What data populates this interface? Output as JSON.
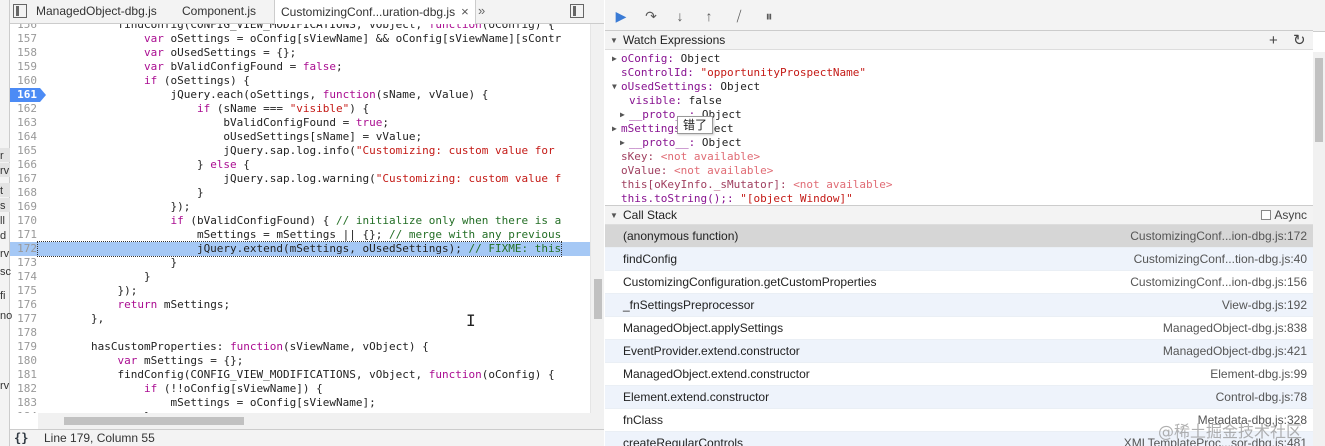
{
  "left_strip": {
    "labels": [
      "r",
      "rv",
      "t",
      "s",
      "ll",
      "d",
      "rv",
      "sc",
      "fi",
      "no",
      "rv"
    ]
  },
  "tabs": [
    {
      "label": "ManagedObject-dbg.js"
    },
    {
      "label": "Component.js"
    },
    {
      "label": "CustomizingConf...uration-dbg.js",
      "close": "×"
    }
  ],
  "more_tabs": "»",
  "code_lines": [
    {
      "n": "156",
      "html": "            findConfig(CONFIG_VIEW_MODIFICATIONS, vObject, <span class=\"kw\">function</span>(oConfig) {"
    },
    {
      "n": "157",
      "html": "                <span class=\"kw\">var</span> oSettings = oConfig[sViewName] &amp;&amp; oConfig[sViewName][sContr"
    },
    {
      "n": "158",
      "html": "                <span class=\"kw\">var</span> oUsedSettings = {};"
    },
    {
      "n": "159",
      "html": "                <span class=\"kw\">var</span> bValidConfigFound = <span class=\"kw\">false</span>;"
    },
    {
      "n": "160",
      "html": "                <span class=\"kw\">if</span> (oSettings) {"
    },
    {
      "n": "161",
      "html": "                    jQuery.each(oSettings, <span class=\"kw\">function</span>(sName, vValue) {",
      "bp": true
    },
    {
      "n": "162",
      "html": "                        <span class=\"kw\">if</span> (sName === <span class=\"st\">\"visible\"</span>) {"
    },
    {
      "n": "163",
      "html": "                            bValidConfigFound = <span class=\"kw\">true</span>;"
    },
    {
      "n": "164",
      "html": "                            oUsedSettings[sName] = vValue;"
    },
    {
      "n": "165",
      "html": "                            jQuery.sap.log.info(<span class=\"st\">\"Customizing: custom value for</span>"
    },
    {
      "n": "166",
      "html": "                        } <span class=\"kw\">else</span> {"
    },
    {
      "n": "167",
      "html": "                            jQuery.sap.log.warning(<span class=\"st\">\"Customizing: custom value f</span>"
    },
    {
      "n": "168",
      "html": "                        }"
    },
    {
      "n": "169",
      "html": "                    });"
    },
    {
      "n": "170",
      "html": "                    <span class=\"kw\">if</span> (bValidConfigFound) { <span class=\"cm\">// initialize only when there is a</span>"
    },
    {
      "n": "171",
      "html": "                        mSettings = mSettings || {}; <span class=\"cm\">// merge with any previous</span>"
    },
    {
      "n": "172",
      "html": "                        jQuery.extend(mSettings, oUsedSettings); <span class=\"cm\">// FIXME: this</span>",
      "hl": true
    },
    {
      "n": "173",
      "html": "                    }"
    },
    {
      "n": "174",
      "html": "                }"
    },
    {
      "n": "175",
      "html": "            });"
    },
    {
      "n": "176",
      "html": "            <span class=\"kw\">return</span> mSettings;"
    },
    {
      "n": "177",
      "html": "        },"
    },
    {
      "n": "178",
      "html": ""
    },
    {
      "n": "179",
      "html": "        hasCustomProperties: <span class=\"kw\">function</span>(sViewName, vObject) {"
    },
    {
      "n": "180",
      "html": "            <span class=\"kw\">var</span> mSettings = {};"
    },
    {
      "n": "181",
      "html": "            findConfig(CONFIG_VIEW_MODIFICATIONS, vObject, <span class=\"kw\">function</span>(oConfig) {"
    },
    {
      "n": "182",
      "html": "                <span class=\"kw\">if</span> (!!oConfig[sViewName]) {"
    },
    {
      "n": "183",
      "html": "                    mSettings = oConfig[sViewName];"
    },
    {
      "n": "184",
      "html": "                }"
    }
  ],
  "status": {
    "braces": "{}",
    "position": "Line 179, Column 55"
  },
  "toolbar": {
    "resume": "▶",
    "step_over": "↷",
    "step_into": "↓",
    "step_out": "↑",
    "deactivate": "⧸",
    "pause_exceptions": "⏸"
  },
  "watch": {
    "title": "Watch Expressions",
    "add": "+",
    "refresh": "↻",
    "lines": [
      {
        "tri": "▶",
        "indent": 0,
        "name": "oConfig",
        "sep": ": ",
        "val": "Object",
        "kind": "obj"
      },
      {
        "tri": "",
        "indent": 0,
        "name": "sControlId",
        "sep": ": ",
        "val": "\"opportunityProspectName\"",
        "kind": "str"
      },
      {
        "tri": "▼",
        "indent": 0,
        "name": "oUsedSettings",
        "sep": ": ",
        "val": "Object",
        "kind": "obj"
      },
      {
        "tri": "",
        "indent": 1,
        "name": "visible",
        "sep": ": ",
        "val": "false",
        "kind": "obj"
      },
      {
        "tri": "▶",
        "indent": 1,
        "name": "__proto__",
        "sep": ": ",
        "val": "Object",
        "kind": "obj"
      },
      {
        "tri": "▶",
        "indent": 0,
        "name": "mSettings",
        "sep": ": ",
        "val": "Object",
        "kind": "obj"
      },
      {
        "tri": "▶",
        "indent": 1,
        "name": "__proto__",
        "sep": ": ",
        "val": "Object",
        "kind": "obj"
      },
      {
        "tri": "",
        "indent": 0,
        "name": "sKey",
        "sep": ": ",
        "val": "<not available>",
        "kind": "na"
      },
      {
        "tri": "",
        "indent": 0,
        "name": "oValue",
        "sep": ": ",
        "val": "<not available>",
        "kind": "na"
      },
      {
        "tri": "",
        "indent": 0,
        "name": "this[oKeyInfo._sMutator]",
        "sep": ": ",
        "val": "<not available>",
        "kind": "na"
      },
      {
        "tri": "",
        "indent": 0,
        "name": "this.toString();",
        "sep": ": ",
        "val": "\"[object Window]\"",
        "kind": "str"
      }
    ],
    "tooltip": "错了"
  },
  "callstack": {
    "title": "Call Stack",
    "async_label": "Async",
    "frames": [
      {
        "fn": "(anonymous function)",
        "loc": "CustomizingConf...ion-dbg.js:172",
        "selected": true
      },
      {
        "fn": "findConfig",
        "loc": "CustomizingConf...tion-dbg.js:40"
      },
      {
        "fn": "CustomizingConfiguration.getCustomProperties",
        "loc": "CustomizingConf...ion-dbg.js:156"
      },
      {
        "fn": "_fnSettingsPreprocessor",
        "loc": "View-dbg.js:192"
      },
      {
        "fn": "ManagedObject.applySettings",
        "loc": "ManagedObject-dbg.js:838"
      },
      {
        "fn": "EventProvider.extend.constructor",
        "loc": "ManagedObject-dbg.js:421"
      },
      {
        "fn": "ManagedObject.extend.constructor",
        "loc": "Element-dbg.js:99"
      },
      {
        "fn": "Element.extend.constructor",
        "loc": "Control-dbg.js:78"
      },
      {
        "fn": "fnClass",
        "loc": "Metadata-dbg.js:328"
      },
      {
        "fn": "createRegularControls",
        "loc": "XMLTemplateProc...sor-dbg.js:481"
      }
    ]
  },
  "watermark": "@稀土掘金技术社区",
  "colors": {
    "breakpoint": "#4c8bf5",
    "highlight_line": "#a5c8f5",
    "selected_frame": "#d6d6d6"
  }
}
